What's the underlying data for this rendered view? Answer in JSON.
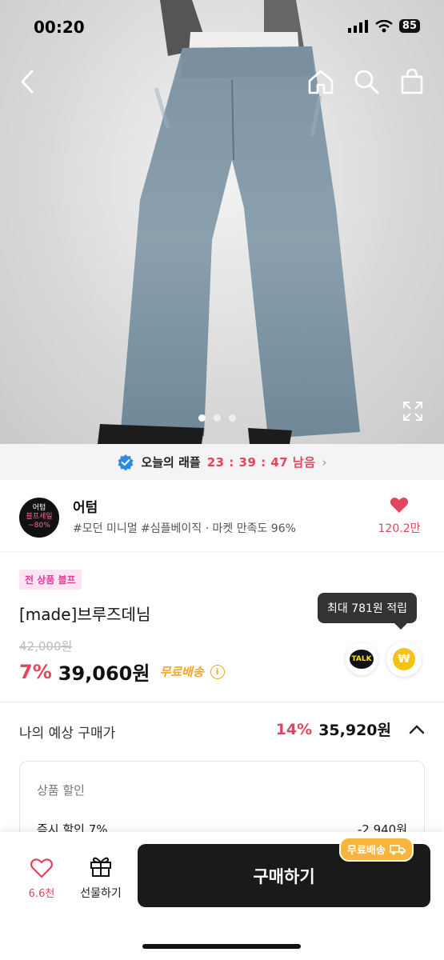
{
  "status_bar": {
    "time": "00:20",
    "battery": "85"
  },
  "raffle": {
    "label": "오늘의 래플",
    "timer": "23 : 39 : 47 남음"
  },
  "shop": {
    "logo_lines": [
      "어텀",
      "블프세일",
      "~80%"
    ],
    "name": "어텀",
    "tags": "#모던 미니멀 #심플베이직 · 마켓 만족도 96%",
    "likes": "120.2만"
  },
  "product": {
    "badge": "전 상품 블프",
    "name": "[made]브루즈데님",
    "original_price": "42,000원",
    "discount_pct": "7%",
    "price": "39,060원",
    "shipping": "무료배송",
    "reward_tooltip": "최대 781원 적립",
    "talk_label": "TALK",
    "coin_symbol": "₩"
  },
  "estimate": {
    "label": "나의 예상 구매가",
    "pct": "14%",
    "price": "35,920원",
    "box_header": "상품 할인",
    "row_label": "즉시 할인 7%",
    "row_value": "-2,940원"
  },
  "bottom_bar": {
    "like_count": "6.6천",
    "gift_label": "선물하기",
    "buy_label": "구매하기",
    "free_badge": "무료배송"
  },
  "colors": {
    "accent": "#e2455f",
    "shipping": "#f5a623",
    "buy_button": "#1a1a1a"
  },
  "icons": [
    "back-arrow-icon",
    "home-icon",
    "search-icon",
    "shopping-bag-icon",
    "expand-icon",
    "verified-check-icon",
    "heart-icon",
    "info-icon",
    "gift-icon",
    "truck-icon"
  ]
}
